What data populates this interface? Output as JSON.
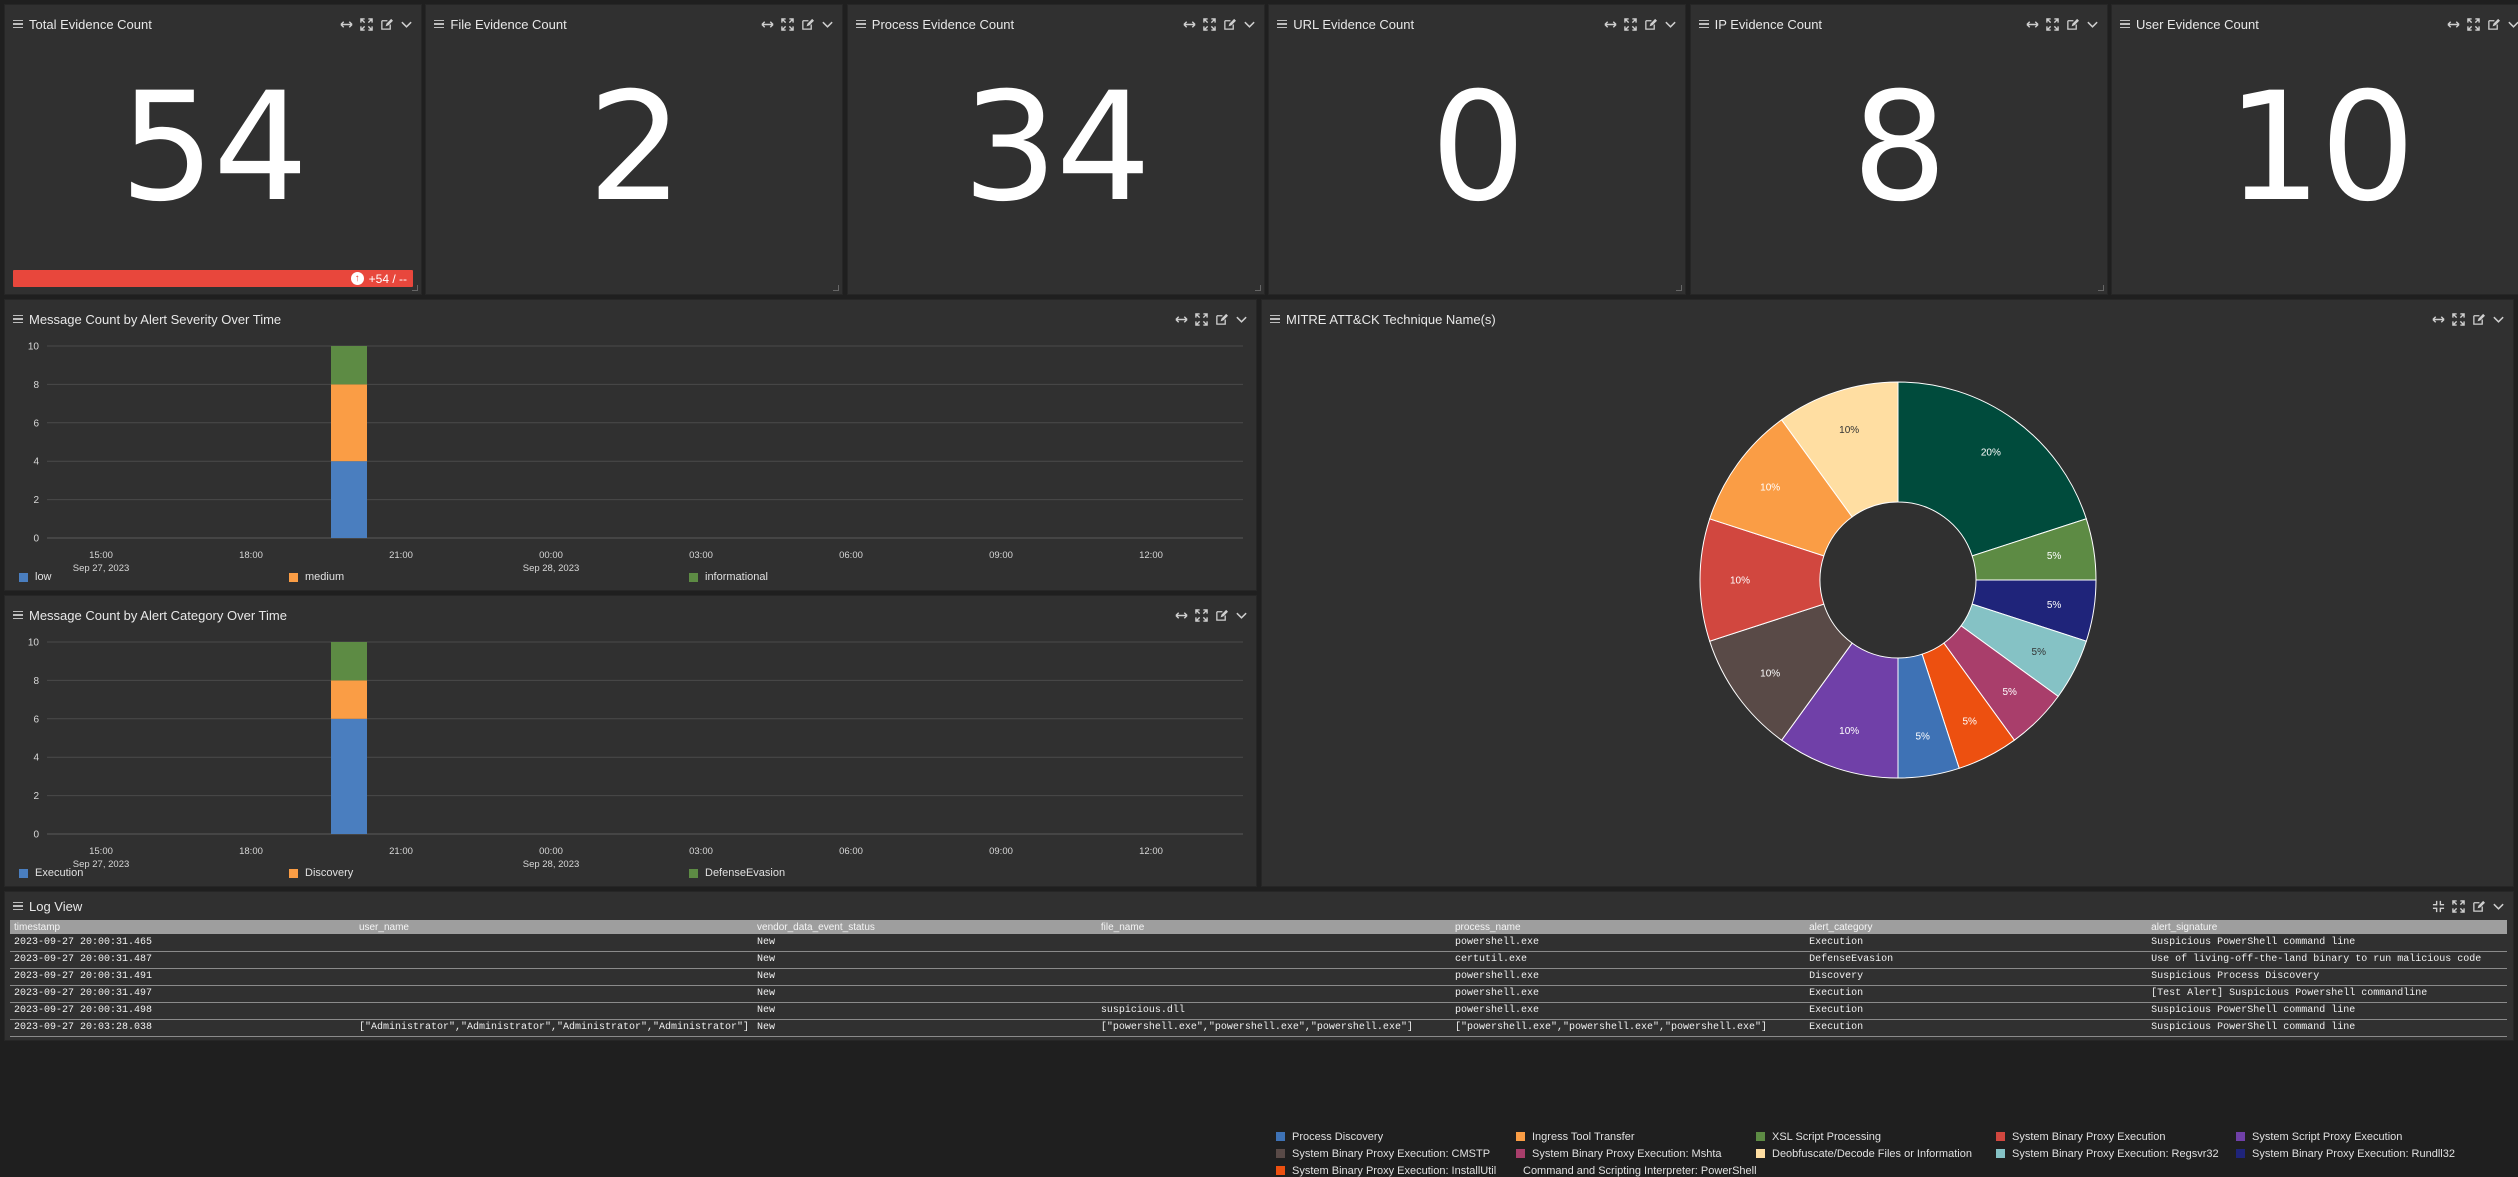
{
  "colors": {
    "panel_bg": "#303030",
    "page_bg": "#1f1f1f",
    "delta_red": "#e8473c",
    "low": "#4a7ebf",
    "medium": "#fa9d45",
    "informational": "#5d8b44"
  },
  "stat_panels": [
    {
      "title": "Total Evidence Count",
      "value": "54",
      "delta": "+54 / --"
    },
    {
      "title": "File Evidence Count",
      "value": "2"
    },
    {
      "title": "Process Evidence Count",
      "value": "34"
    },
    {
      "title": "URL Evidence Count",
      "value": "0"
    },
    {
      "title": "IP Evidence Count",
      "value": "8"
    },
    {
      "title": "User Evidence Count",
      "value": "10"
    }
  ],
  "panel_icons": [
    "hamburger-icon",
    "move-horizontal-icon",
    "fullscreen-icon",
    "edit-icon",
    "chevron-down-icon"
  ],
  "severity_chart": {
    "title": "Message Count by Alert Severity Over Time",
    "yticks": [
      "0",
      "2",
      "4",
      "6",
      "8",
      "10"
    ],
    "xticks": [
      "15:00",
      "18:00",
      "21:00",
      "00:00",
      "03:00",
      "06:00",
      "09:00",
      "12:00"
    ],
    "date_labels": [
      "Sep 27, 2023",
      "Sep 28, 2023"
    ],
    "legend": [
      "low",
      "medium",
      "informational"
    ]
  },
  "category_chart": {
    "title": "Message Count by Alert Category Over Time",
    "yticks": [
      "0",
      "2",
      "4",
      "6",
      "8",
      "10"
    ],
    "xticks": [
      "15:00",
      "18:00",
      "21:00",
      "00:00",
      "03:00",
      "06:00",
      "09:00",
      "12:00"
    ],
    "date_labels": [
      "Sep 27, 2023",
      "Sep 28, 2023"
    ],
    "legend": [
      "Execution",
      "Discovery",
      "DefenseEvasion"
    ]
  },
  "pie_panel": {
    "title": "MITRE ATT&CK Technique Name(s)"
  },
  "chart_data": [
    {
      "type": "bar",
      "stacked": true,
      "x": [
        "2023-09-27 20:00"
      ],
      "ylim": [
        0,
        10
      ],
      "grid": true,
      "legend_position": "bottom",
      "series": [
        {
          "name": "low",
          "values": [
            4
          ],
          "color": "#4a7ebf"
        },
        {
          "name": "medium",
          "values": [
            4
          ],
          "color": "#fa9d45"
        },
        {
          "name": "informational",
          "values": [
            2
          ],
          "color": "#5d8b44"
        }
      ]
    },
    {
      "type": "bar",
      "stacked": true,
      "x": [
        "2023-09-27 20:00"
      ],
      "ylim": [
        0,
        10
      ],
      "grid": true,
      "legend_position": "bottom",
      "series": [
        {
          "name": "Execution",
          "values": [
            6
          ],
          "color": "#4a7ebf"
        },
        {
          "name": "Discovery",
          "values": [
            2
          ],
          "color": "#fa9d45"
        },
        {
          "name": "DefenseEvasion",
          "values": [
            2
          ],
          "color": "#5d8b44"
        }
      ]
    },
    {
      "type": "pie",
      "donut": true,
      "legend_position": "bottom",
      "slices": [
        {
          "label": "Command and Scripting Interpreter: PowerShell",
          "value": 20,
          "display": "20%",
          "color": "#004b3c"
        },
        {
          "label": "XSL Script Processing",
          "value": 5,
          "display": "5%",
          "color": "#5d8b44"
        },
        {
          "label": "System Binary Proxy Execution: Rundll32",
          "value": 5,
          "display": "5%",
          "color": "#1f247a"
        },
        {
          "label": "System Binary Proxy Execution: Regsvr32",
          "value": 5,
          "display": "5%",
          "color": "#85c2c5"
        },
        {
          "label": "System Binary Proxy Execution: Mshta",
          "value": 5,
          "display": "5%",
          "color": "#a93e6b"
        },
        {
          "label": "System Binary Proxy Execution: InstallUtil",
          "value": 5,
          "display": "5%",
          "color": "#ed5010"
        },
        {
          "label": "Process Discovery",
          "value": 5,
          "display": "5%",
          "color": "#3e72b5"
        },
        {
          "label": "System Script Proxy Execution",
          "value": 10,
          "display": "10%",
          "color": "#7040a8"
        },
        {
          "label": "System Binary Proxy Execution: CMSTP",
          "value": 10,
          "display": "10%",
          "color": "#594a47"
        },
        {
          "label": "System Binary Proxy Execution",
          "value": 10,
          "display": "10%",
          "color": "#d1473f"
        },
        {
          "label": "Ingress Tool Transfer",
          "value": 10,
          "display": "10%",
          "color": "#fa9d45"
        },
        {
          "label": "Deobfuscate/Decode Files or Information",
          "value": 10,
          "display": "10%",
          "color": "#ffdea2"
        }
      ],
      "legend_order": [
        "Process Discovery",
        "Ingress Tool Transfer",
        "XSL Script Processing",
        "System Binary Proxy Execution",
        "System Script Proxy Execution",
        "System Binary Proxy Execution: CMSTP",
        "System Binary Proxy Execution: Mshta",
        "Deobfuscate/Decode Files or Information",
        "System Binary Proxy Execution: Regsvr32",
        "System Binary Proxy Execution: Rundll32",
        "System Binary Proxy Execution: InstallUtil",
        "Command and Scripting Interpreter: PowerShell"
      ]
    }
  ],
  "log_view": {
    "title": "Log View",
    "columns": [
      "timestamp",
      "user_name",
      "vendor_data_event_status",
      "file_name",
      "process_name",
      "alert_category",
      "alert_signature"
    ],
    "rows": [
      [
        "2023-09-27 20:00:31.465",
        "",
        "New",
        "",
        "powershell.exe",
        "Execution",
        "Suspicious PowerShell command line"
      ],
      [
        "2023-09-27 20:00:31.487",
        "",
        "New",
        "",
        "certutil.exe",
        "DefenseEvasion",
        "Use of living-off-the-land binary to run malicious code"
      ],
      [
        "2023-09-27 20:00:31.491",
        "",
        "New",
        "",
        "powershell.exe",
        "Discovery",
        "Suspicious Process Discovery"
      ],
      [
        "2023-09-27 20:00:31.497",
        "",
        "New",
        "",
        "powershell.exe",
        "Execution",
        "[Test Alert] Suspicious Powershell commandline"
      ],
      [
        "2023-09-27 20:00:31.498",
        "",
        "New",
        "suspicious.dll",
        "powershell.exe",
        "Execution",
        "Suspicious PowerShell command line"
      ],
      [
        "2023-09-27 20:03:28.038",
        "[\"Administrator\",\"Administrator\",\"Administrator\",\"Administrator\"]",
        "New",
        "[\"powershell.exe\",\"powershell.exe\",\"powershell.exe\"]",
        "[\"powershell.exe\",\"powershell.exe\",\"powershell.exe\"]",
        "Execution",
        "Suspicious PowerShell command line"
      ]
    ]
  }
}
